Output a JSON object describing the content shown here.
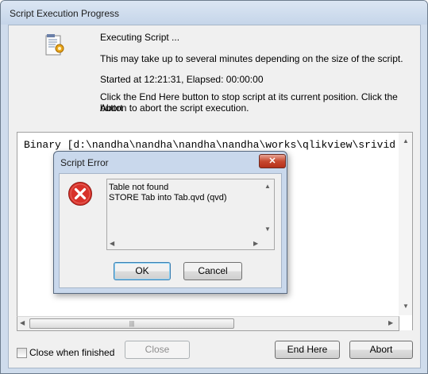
{
  "window": {
    "title": "Script Execution Progress",
    "status": {
      "executing": "Executing Script ...",
      "duration_note": "This may take up to several minutes depending on the size of the script.",
      "started": "Started at 12:21:31, Elapsed: 00:00:00",
      "help_line1": "Click the End Here button to stop script at its current position. Click the Abort",
      "help_line2": "button to abort the script execution."
    },
    "log_text": "Binary [d:\\nandha\\nandha\\nandha\\nandha\\works\\qlikview\\srivid",
    "close_when_finished_label": "Close when finished",
    "close_when_finished_checked": false,
    "buttons": {
      "close": "Close",
      "end_here": "End Here",
      "abort": "Abort"
    },
    "icons": {
      "script": "script-gear-icon"
    }
  },
  "error_dialog": {
    "title": "Script Error",
    "close_glyph": "✕",
    "message_line1": "Table not found",
    "message_line2": "STORE Tab into Tab.qvd (qvd)",
    "ok_label": "OK",
    "cancel_label": "Cancel",
    "icons": {
      "error": "error-icon"
    }
  }
}
